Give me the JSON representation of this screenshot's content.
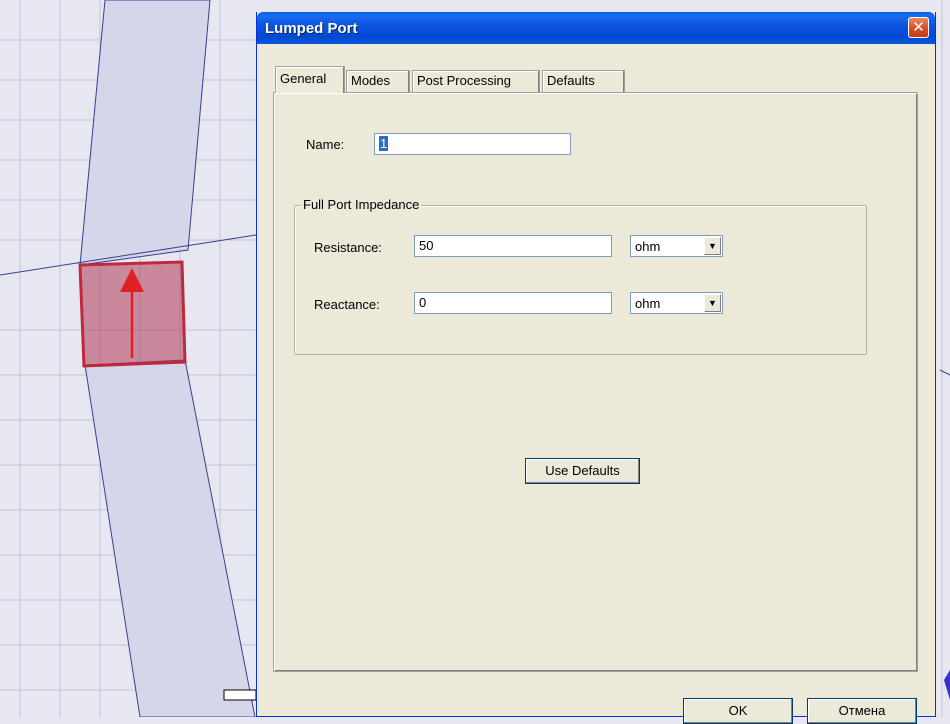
{
  "window": {
    "title": "Lumped Port",
    "close_glyph": "✕"
  },
  "tabs": [
    {
      "label": "General",
      "active": true
    },
    {
      "label": "Modes"
    },
    {
      "label": "Post Processing"
    },
    {
      "label": "Defaults"
    }
  ],
  "general": {
    "name_label": "Name:",
    "name_value": "1",
    "group_title": "Full Port Impedance",
    "resistance_label": "Resistance:",
    "resistance_value": "50",
    "resistance_unit": "ohm",
    "reactance_label": "Reactance:",
    "reactance_value": "0",
    "reactance_unit": "ohm",
    "use_defaults_label": "Use Defaults"
  },
  "footer": {
    "ok_label": "OK",
    "cancel_label": "Отмена"
  },
  "icons": {
    "dropdown": "▼"
  },
  "colors": {
    "titlebar": "#0a56d8",
    "port_fill": "#b03a58",
    "scene_bg": "#e6e7f0"
  }
}
